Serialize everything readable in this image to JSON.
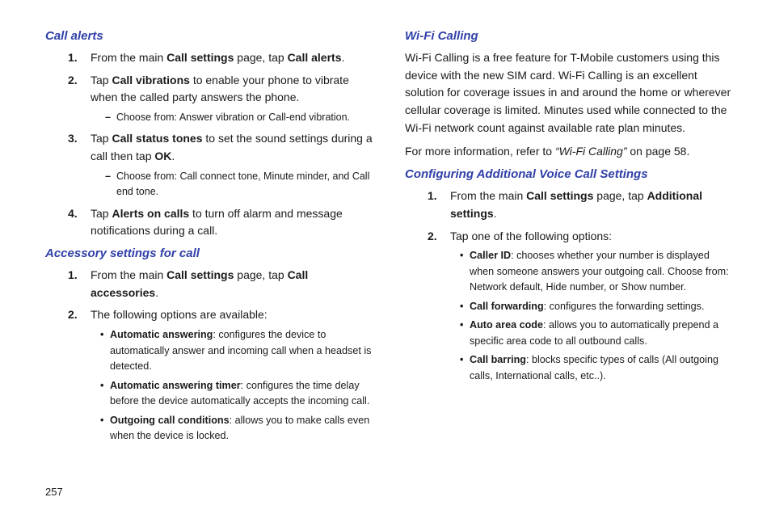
{
  "page_number": "257",
  "left": {
    "call_alerts": {
      "heading": "Call alerts",
      "items": [
        {
          "num": "1.",
          "pre": "From the main ",
          "b1": "Call settings",
          "mid": " page, tap ",
          "b2": "Call alerts",
          "post": "."
        },
        {
          "num": "2.",
          "pre": "Tap ",
          "b1": "Call vibrations",
          "post": " to enable your phone to vibrate when the called party answers the phone.",
          "dash": [
            "Choose from: Answer vibration or Call-end vibration."
          ]
        },
        {
          "num": "3.",
          "pre": "Tap ",
          "b1": "Call status tones",
          "mid": " to set the sound settings during a call then tap ",
          "b2": "OK",
          "post": ".",
          "dash": [
            "Choose from: Call connect tone, Minute minder, and Call end tone."
          ]
        },
        {
          "num": "4.",
          "pre": "Tap ",
          "b1": "Alerts on calls",
          "post": " to turn off alarm and message notifications during a call."
        }
      ]
    },
    "accessory": {
      "heading": "Accessory settings for call",
      "items": [
        {
          "num": "1.",
          "pre": "From the main ",
          "b1": "Call settings",
          "mid": " page, tap ",
          "b2": "Call accessories",
          "post": "."
        },
        {
          "num": "2.",
          "text": "The following options are available:",
          "bullets": [
            {
              "b": "Automatic answering",
              "rest": ": configures the device to automatically answer and incoming call when a headset is detected."
            },
            {
              "b": "Automatic answering timer",
              "rest": ": configures the time delay before the device automatically accepts the incoming call."
            },
            {
              "b": "Outgoing call conditions",
              "rest": ": allows you to make calls even when the device is locked."
            }
          ]
        }
      ]
    }
  },
  "right": {
    "wifi": {
      "heading": "Wi-Fi Calling",
      "para1": "Wi-Fi Calling is a free feature for T-Mobile customers using this device with the new SIM card. Wi-Fi Calling is an excellent solution for coverage issues in and around the home or wherever cellular coverage is limited. Minutes used while connected to the Wi-Fi network count against available rate plan minutes.",
      "xref_pre": "For more information, refer to ",
      "xref_link": "“Wi-Fi Calling”",
      "xref_post": "  on page 58."
    },
    "config": {
      "heading": "Configuring Additional Voice Call Settings",
      "items": [
        {
          "num": "1.",
          "pre": "From the main ",
          "b1": "Call settings",
          "mid": " page, tap ",
          "b2": "Additional settings",
          "post": "."
        },
        {
          "num": "2.",
          "text": "Tap one of the following options:",
          "bullets": [
            {
              "b": "Caller ID",
              "rest": ": chooses whether your number is displayed when someone answers your outgoing call. Choose from: Network default, Hide number, or Show number."
            },
            {
              "b": "Call forwarding",
              "rest": ": configures the forwarding settings."
            },
            {
              "b": "Auto area code",
              "rest": ": allows you to automatically prepend a specific area code to all outbound calls."
            },
            {
              "b": "Call barring",
              "rest": ": blocks specific types of calls (All outgoing calls, International calls, etc..)."
            }
          ]
        }
      ]
    }
  }
}
